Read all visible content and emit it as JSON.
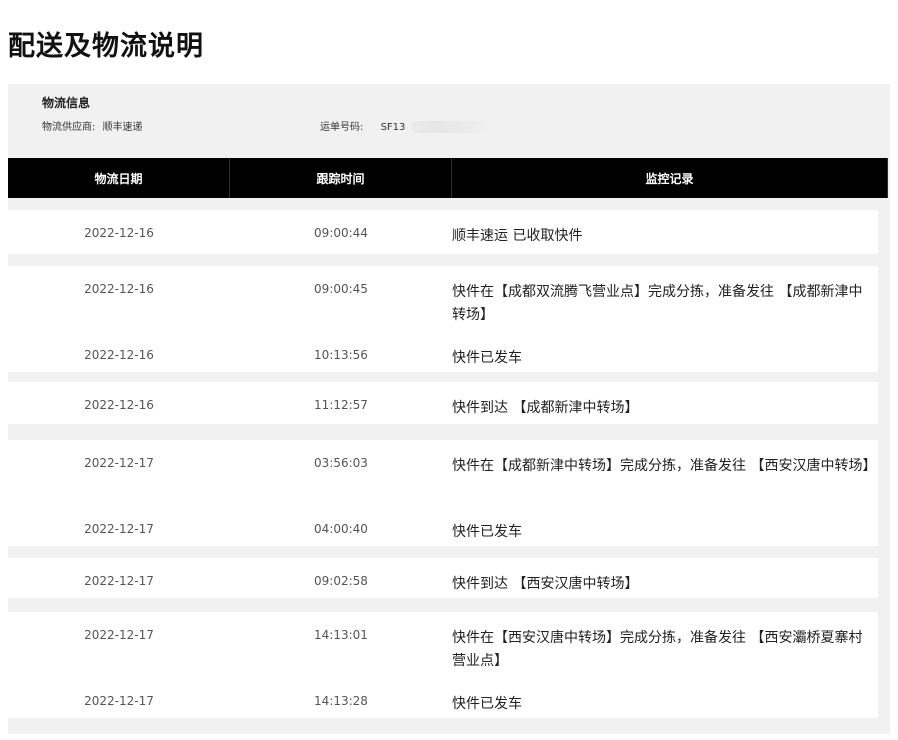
{
  "page": {
    "title": "配送及物流说明"
  },
  "info": {
    "heading": "物流信息",
    "provider_label": "物流供应商:",
    "provider_value": "顺丰速递",
    "waybill_label": "运单号码:",
    "waybill_value": "SF13"
  },
  "table": {
    "headers": [
      "物流日期",
      "跟踪时间",
      "监控记录"
    ],
    "rows": [
      {
        "date": "2022-12-16",
        "time": "09:00:44",
        "record": "顺丰速运 已收取快件"
      },
      {
        "date": "2022-12-16",
        "time": "09:00:45",
        "record": "快件在【成都双流腾飞营业点】完成分拣，准备发往 【成都新津中转场】"
      },
      {
        "date": "2022-12-16",
        "time": "10:13:56",
        "record": "快件已发车"
      },
      {
        "date": "2022-12-16",
        "time": "11:12:57",
        "record": "快件到达 【成都新津中转场】"
      },
      {
        "date": "2022-12-17",
        "time": "03:56:03",
        "record": "快件在【成都新津中转场】完成分拣，准备发往 【西安汉唐中转场】"
      },
      {
        "date": "2022-12-17",
        "time": "04:00:40",
        "record": "快件已发车"
      },
      {
        "date": "2022-12-17",
        "time": "09:02:58",
        "record": "快件到达 【西安汉唐中转场】"
      },
      {
        "date": "2022-12-17",
        "time": "14:13:01",
        "record": "快件在【西安汉唐中转场】完成分拣，准备发往 【西安灞桥夏寨村营业点】"
      },
      {
        "date": "2022-12-17",
        "time": "14:13:28",
        "record": "快件已发车"
      }
    ]
  }
}
